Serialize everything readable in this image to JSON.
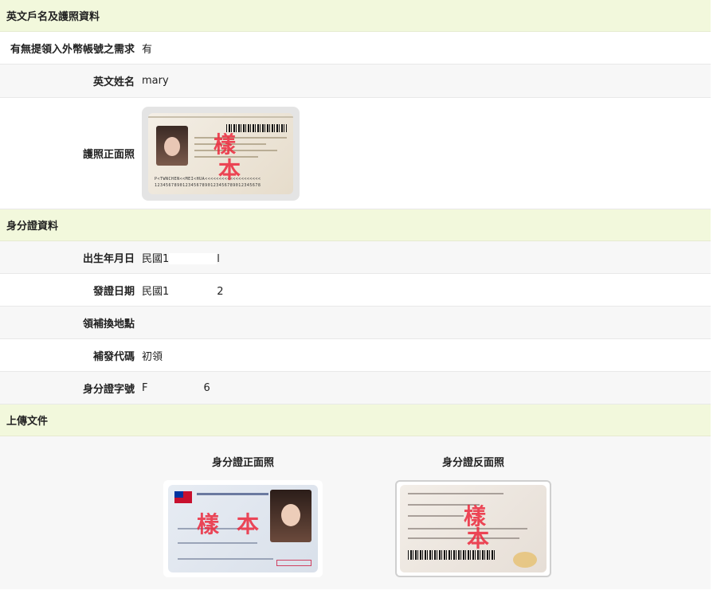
{
  "sections": {
    "passport": "英文戶名及護照資料",
    "idcard": "身分證資料",
    "upload": "上傳文件"
  },
  "passport": {
    "fx_label": "有無提領入外幣帳號之需求",
    "fx_value": "有",
    "eng_name_label": "英文姓名",
    "eng_name_value": "mary",
    "photo_label": "護照正面照"
  },
  "idcard": {
    "birth_label": "出生年月日",
    "birth_value_prefix": "民國1",
    "birth_value_suffix": "l",
    "issue_label": "發證日期",
    "issue_value_prefix": "民國1",
    "issue_value_suffix": "2",
    "place_label": "領補換地點",
    "place_value": "",
    "reissue_label": "補發代碼",
    "reissue_value": "初領",
    "id_label": "身分證字號",
    "id_value_prefix": "F",
    "id_value_suffix": "6"
  },
  "upload": {
    "front_label": "身分證正面照",
    "back_label": "身分證反面照"
  },
  "sample_mark": {
    "char1": "樣",
    "char2": "本"
  },
  "colors": {
    "section_bg": "#f2f8dc",
    "row_alt": "#f7f7f7",
    "watermark": "#eb283c"
  }
}
